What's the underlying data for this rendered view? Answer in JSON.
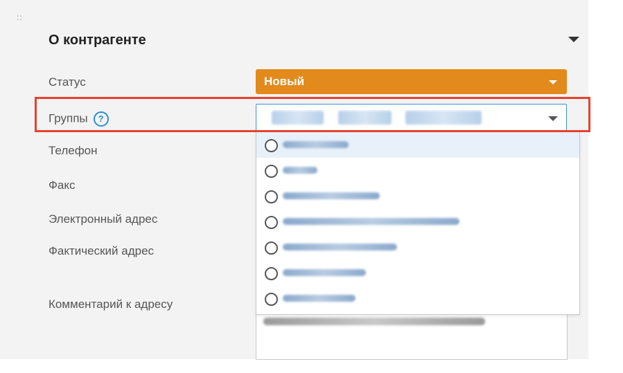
{
  "panel": {
    "title": "О контрагенте",
    "drag_handle_icon": "drag-handle-icon",
    "collapse_icon": "chevron-down-icon"
  },
  "fields": {
    "status_label": "Статус",
    "groups_label": "Группы",
    "groups_help_glyph": "?",
    "phone_label": "Телефон",
    "fax_label": "Факс",
    "email_label": "Электронный адрес",
    "actual_address_label": "Фактический адрес",
    "address_comment_label": "Комментарий к адресу"
  },
  "status_select": {
    "value": "Новый",
    "color": "#e38a1c"
  },
  "groups_select": {
    "selected_chips": [
      "",
      "",
      ""
    ]
  },
  "groups_dropdown": {
    "options": [
      {
        "label": "",
        "checked": false,
        "highlighted": true
      },
      {
        "label": "",
        "checked": false,
        "highlighted": false
      },
      {
        "label": "",
        "checked": false,
        "highlighted": false
      },
      {
        "label": "",
        "checked": false,
        "highlighted": false
      },
      {
        "label": "",
        "checked": false,
        "highlighted": false
      },
      {
        "label": "",
        "checked": false,
        "highlighted": false
      },
      {
        "label": "",
        "checked": false,
        "highlighted": false
      }
    ]
  },
  "annotation": {
    "highlight_color": "#e7412e"
  }
}
